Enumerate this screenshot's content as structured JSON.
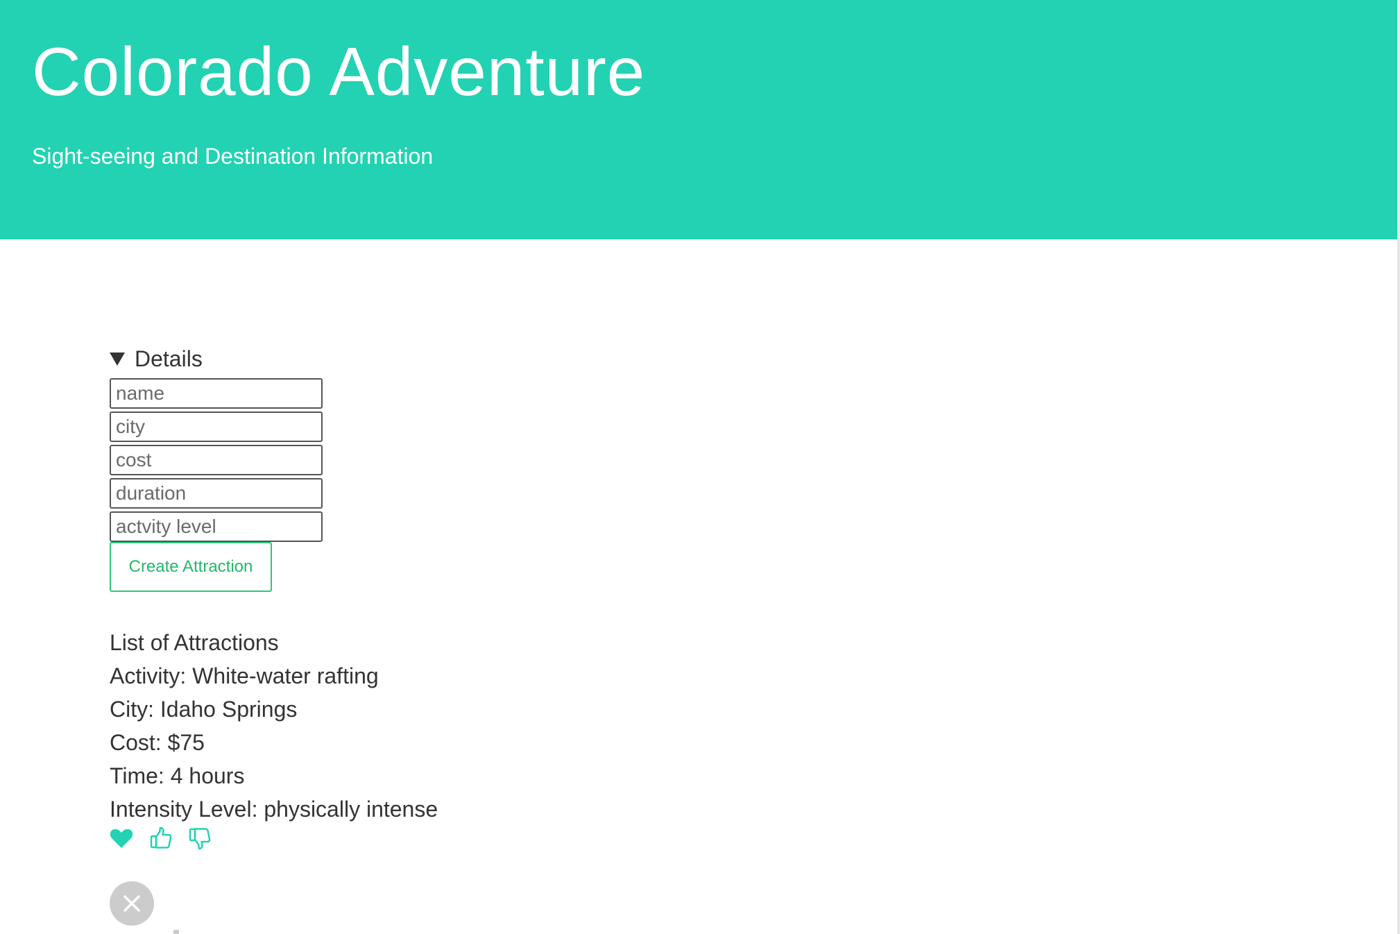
{
  "header": {
    "title": "Colorado Adventure",
    "subtitle": "Sight-seeing and Destination Information"
  },
  "form": {
    "summary_label": "Details",
    "fields": [
      {
        "placeholder": "name",
        "value": ""
      },
      {
        "placeholder": "city",
        "value": ""
      },
      {
        "placeholder": "cost",
        "value": ""
      },
      {
        "placeholder": "duration",
        "value": ""
      },
      {
        "placeholder": "actvity level",
        "value": ""
      }
    ],
    "submit_label": "Create Attraction"
  },
  "list": {
    "heading": "List of Attractions",
    "items": [
      {
        "activity": "Activity: White-water rafting",
        "city": "City: Idaho Springs",
        "cost": "Cost: $75",
        "time": "Time: 4 hours",
        "intensity": "Intensity Level: physically intense",
        "actions": [
          "heart-icon",
          "thumbs-up-icon",
          "thumbs-down-icon"
        ]
      }
    ]
  },
  "controls": {
    "close_icon": "close-icon"
  },
  "colors": {
    "hero_background": "#23d2b2",
    "hero_text": "#ffffff",
    "accent_icon": "#23d2b2",
    "button_border": "#2ec77a",
    "button_text": "#24b868",
    "body_text": "#333333",
    "close_background": "#cccccc"
  }
}
